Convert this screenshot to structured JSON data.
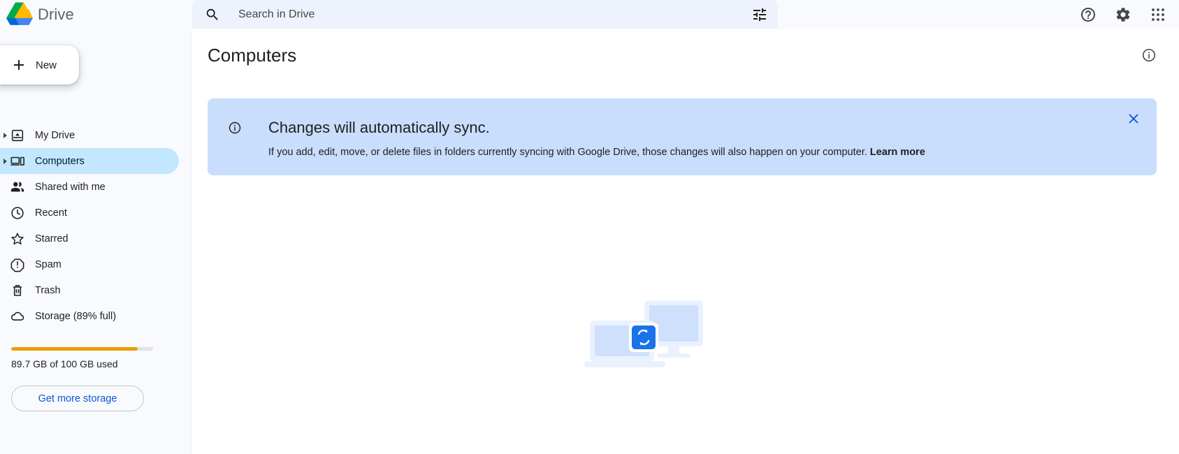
{
  "app": {
    "brand": "Drive",
    "logo_icon": "drive-logo-icon"
  },
  "search": {
    "placeholder": "Search in Drive",
    "value": "",
    "search_icon": "search-icon",
    "tune_icon": "tune-icon"
  },
  "topbar_actions": [
    {
      "name": "help-icon",
      "label": "Help"
    },
    {
      "name": "settings-icon",
      "label": "Settings"
    },
    {
      "name": "apps-grid-icon",
      "label": "Google apps"
    }
  ],
  "sidebar": {
    "new_button": {
      "label": "New",
      "icon": "plus-icon"
    },
    "items": [
      {
        "label": "My Drive",
        "icon": "my-drive-icon",
        "expandable": true,
        "active": false
      },
      {
        "label": "Computers",
        "icon": "computer-icon",
        "expandable": true,
        "active": true
      },
      {
        "label": "Shared with me",
        "icon": "people-icon",
        "expandable": false,
        "active": false
      },
      {
        "label": "Recent",
        "icon": "clock-icon",
        "expandable": false,
        "active": false
      },
      {
        "label": "Starred",
        "icon": "star-icon",
        "expandable": false,
        "active": false
      },
      {
        "label": "Spam",
        "icon": "spam-icon",
        "expandable": false,
        "active": false
      },
      {
        "label": "Trash",
        "icon": "trash-icon",
        "expandable": false,
        "active": false
      },
      {
        "label": "Storage (89% full)",
        "icon": "cloud-icon",
        "expandable": false,
        "active": false
      }
    ],
    "storage": {
      "percent_full": 89,
      "bar_color": "#f29900",
      "usage_text": "89.7 GB of 100 GB used",
      "get_more_label": "Get more storage"
    }
  },
  "main": {
    "page_title": "Computers",
    "info_icon": "info-outline-icon",
    "banner": {
      "icon": "info-outline-icon",
      "title": "Changes will automatically sync.",
      "description": "If you add, edit, move, or delete files in folders currently syncing with Google Drive, those changes will also happen on your computer. ",
      "link_label": "Learn more",
      "close_icon": "close-icon",
      "background": "#c9ddfc"
    },
    "empty_state": {
      "illustration": "computer-sync-illustration",
      "accent_color": "#1a73e8"
    }
  }
}
